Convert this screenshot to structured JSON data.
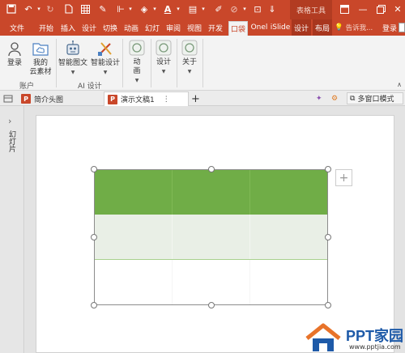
{
  "window": {
    "context_tab_group": "表格工具"
  },
  "tabs": [
    {
      "label": "文件"
    },
    {
      "label": "开始"
    },
    {
      "label": "插入"
    },
    {
      "label": "设计"
    },
    {
      "label": "切换"
    },
    {
      "label": "动画"
    },
    {
      "label": "幻灯"
    },
    {
      "label": "审阅"
    },
    {
      "label": "视图"
    },
    {
      "label": "开发"
    },
    {
      "label": "口袋"
    },
    {
      "label": "Onel"
    },
    {
      "label": "iSlide"
    },
    {
      "label": "设计"
    },
    {
      "label": "布局"
    }
  ],
  "search": {
    "label": "告诉我..."
  },
  "login": {
    "label": "登录"
  },
  "ribbon": {
    "login_btn": "登录",
    "material_btn_line1": "我的",
    "material_btn_line2": "云素材",
    "group_account": "账户",
    "smart_text_btn": "智能图文",
    "smart_design_btn": "智能设计",
    "group_ai": "AI 设计",
    "anim_btn_line1": "动",
    "anim_btn_line2": "画",
    "design_btn": "设计",
    "about_btn": "关于"
  },
  "doc_tabs": [
    {
      "label": "简介头图"
    },
    {
      "label": "演示文稿1"
    }
  ],
  "multi_window": "多窗口模式",
  "left_pane": {
    "label": "幻灯片"
  },
  "table": {
    "rows": 3,
    "cols": 3,
    "header_color": "#70ad47",
    "band_color": "#e9efe6"
  },
  "watermark": {
    "brand": "PPT家园",
    "url": "www.pptjia.com"
  },
  "colors": {
    "accent": "#c9472a",
    "table_header": "#70ad47"
  }
}
